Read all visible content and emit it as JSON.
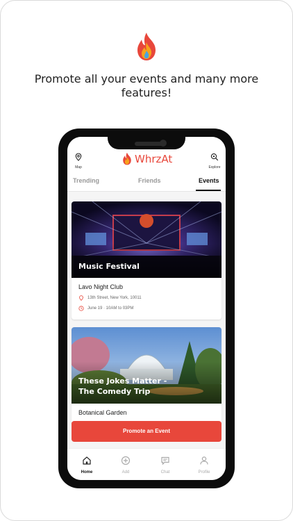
{
  "headline": "Promote all your events and many more features!",
  "brand": {
    "name": "WhrzAt",
    "accent": "#e8473b"
  },
  "top_bar": {
    "map_label": "Map",
    "explore_label": "Explore"
  },
  "tabs": [
    {
      "label": "Trending",
      "active": false
    },
    {
      "label": "Friends",
      "active": false
    },
    {
      "label": "Events",
      "active": true
    }
  ],
  "events": [
    {
      "title": "Music Festival",
      "venue": "Lavo Night Club",
      "address": "13th Street, New York, 10011",
      "time": "June 19 · 10AM to 03PM"
    },
    {
      "title_line1": "These Jokes Matter -",
      "title_line2": "The Comedy Trip",
      "venue": "Botanical Garden"
    }
  ],
  "promote_button": "Promote an Event",
  "bottom_nav": [
    {
      "label": "Home",
      "icon": "home-icon",
      "active": true
    },
    {
      "label": "Add",
      "icon": "add-icon",
      "active": false
    },
    {
      "label": "Chat",
      "icon": "chat-icon",
      "active": false
    },
    {
      "label": "Profile",
      "icon": "profile-icon",
      "active": false
    }
  ]
}
